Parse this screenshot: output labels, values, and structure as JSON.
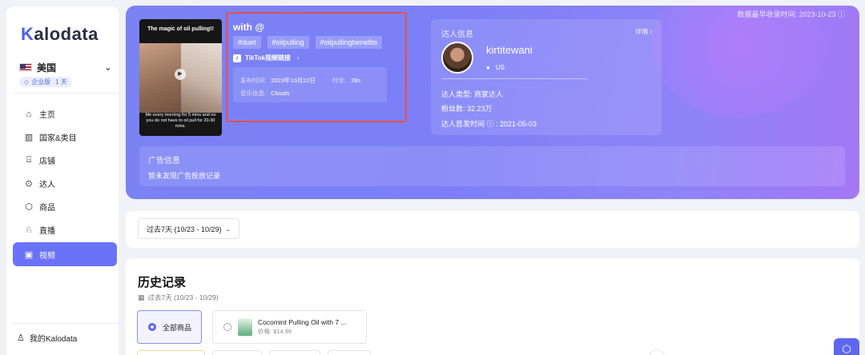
{
  "brand": {
    "logo_k": "K",
    "logo_rest": "alodata"
  },
  "region": {
    "name": "美国",
    "plan": "企业版",
    "days": "1 天"
  },
  "nav": [
    {
      "label": "主页",
      "icon": "⌂",
      "name": "home"
    },
    {
      "label": "国家&类目",
      "icon": "▥",
      "name": "country-category"
    },
    {
      "label": "店铺",
      "icon": "⌸",
      "name": "shop"
    },
    {
      "label": "达人",
      "icon": "⊙",
      "name": "creator"
    },
    {
      "label": "商品",
      "icon": "⬡",
      "name": "product"
    },
    {
      "label": "直播",
      "icon": "♘",
      "name": "live"
    },
    {
      "label": "视频",
      "icon": "▣",
      "name": "video"
    }
  ],
  "sidebar_bottom": {
    "mine": "我的Kalodata",
    "second": "                …"
  },
  "hero": {
    "update_time": "数据最早收录时间: 2023-10-23 ⓘ",
    "thumb_title": "The magic of oil pulling!!",
    "thumb_caption": "Me every morning for 5 mins and no you do not have to oil pull for 20-30 mins.",
    "video_title": "with @",
    "tags": [
      "#duet",
      "#oilpulling",
      "#oilpullingbenefits"
    ],
    "tiktok_link": "TikTok视频链接",
    "publish_label": "发布时间:",
    "publish_value": "2023年10月22日",
    "duration_label": "时长:",
    "duration_value": "28s",
    "music_label": "音乐信息:",
    "music_value": "Clouds"
  },
  "creator": {
    "header": "达人信息",
    "detail": "详情 ›",
    "name": "kirtitewani",
    "location": "US",
    "type": "达人类型: 商家达人",
    "followers": "粉丝数: 32.23万",
    "first_post": "达人首发时间 ⓘ : 2021-05-03"
  },
  "ads": {
    "header": "广告信息",
    "text": "暂未发现广告投放记录"
  },
  "filter": {
    "date_range": "过去7天 (10/23 - 10/29)"
  },
  "history": {
    "title": "历史记录",
    "subtitle": "过去7天 (10/23 - 10/29)",
    "all_products": "全部商品",
    "product_name": "Cocomint Pulling Oil with 7 ...",
    "product_price": "价格: $14.99"
  }
}
